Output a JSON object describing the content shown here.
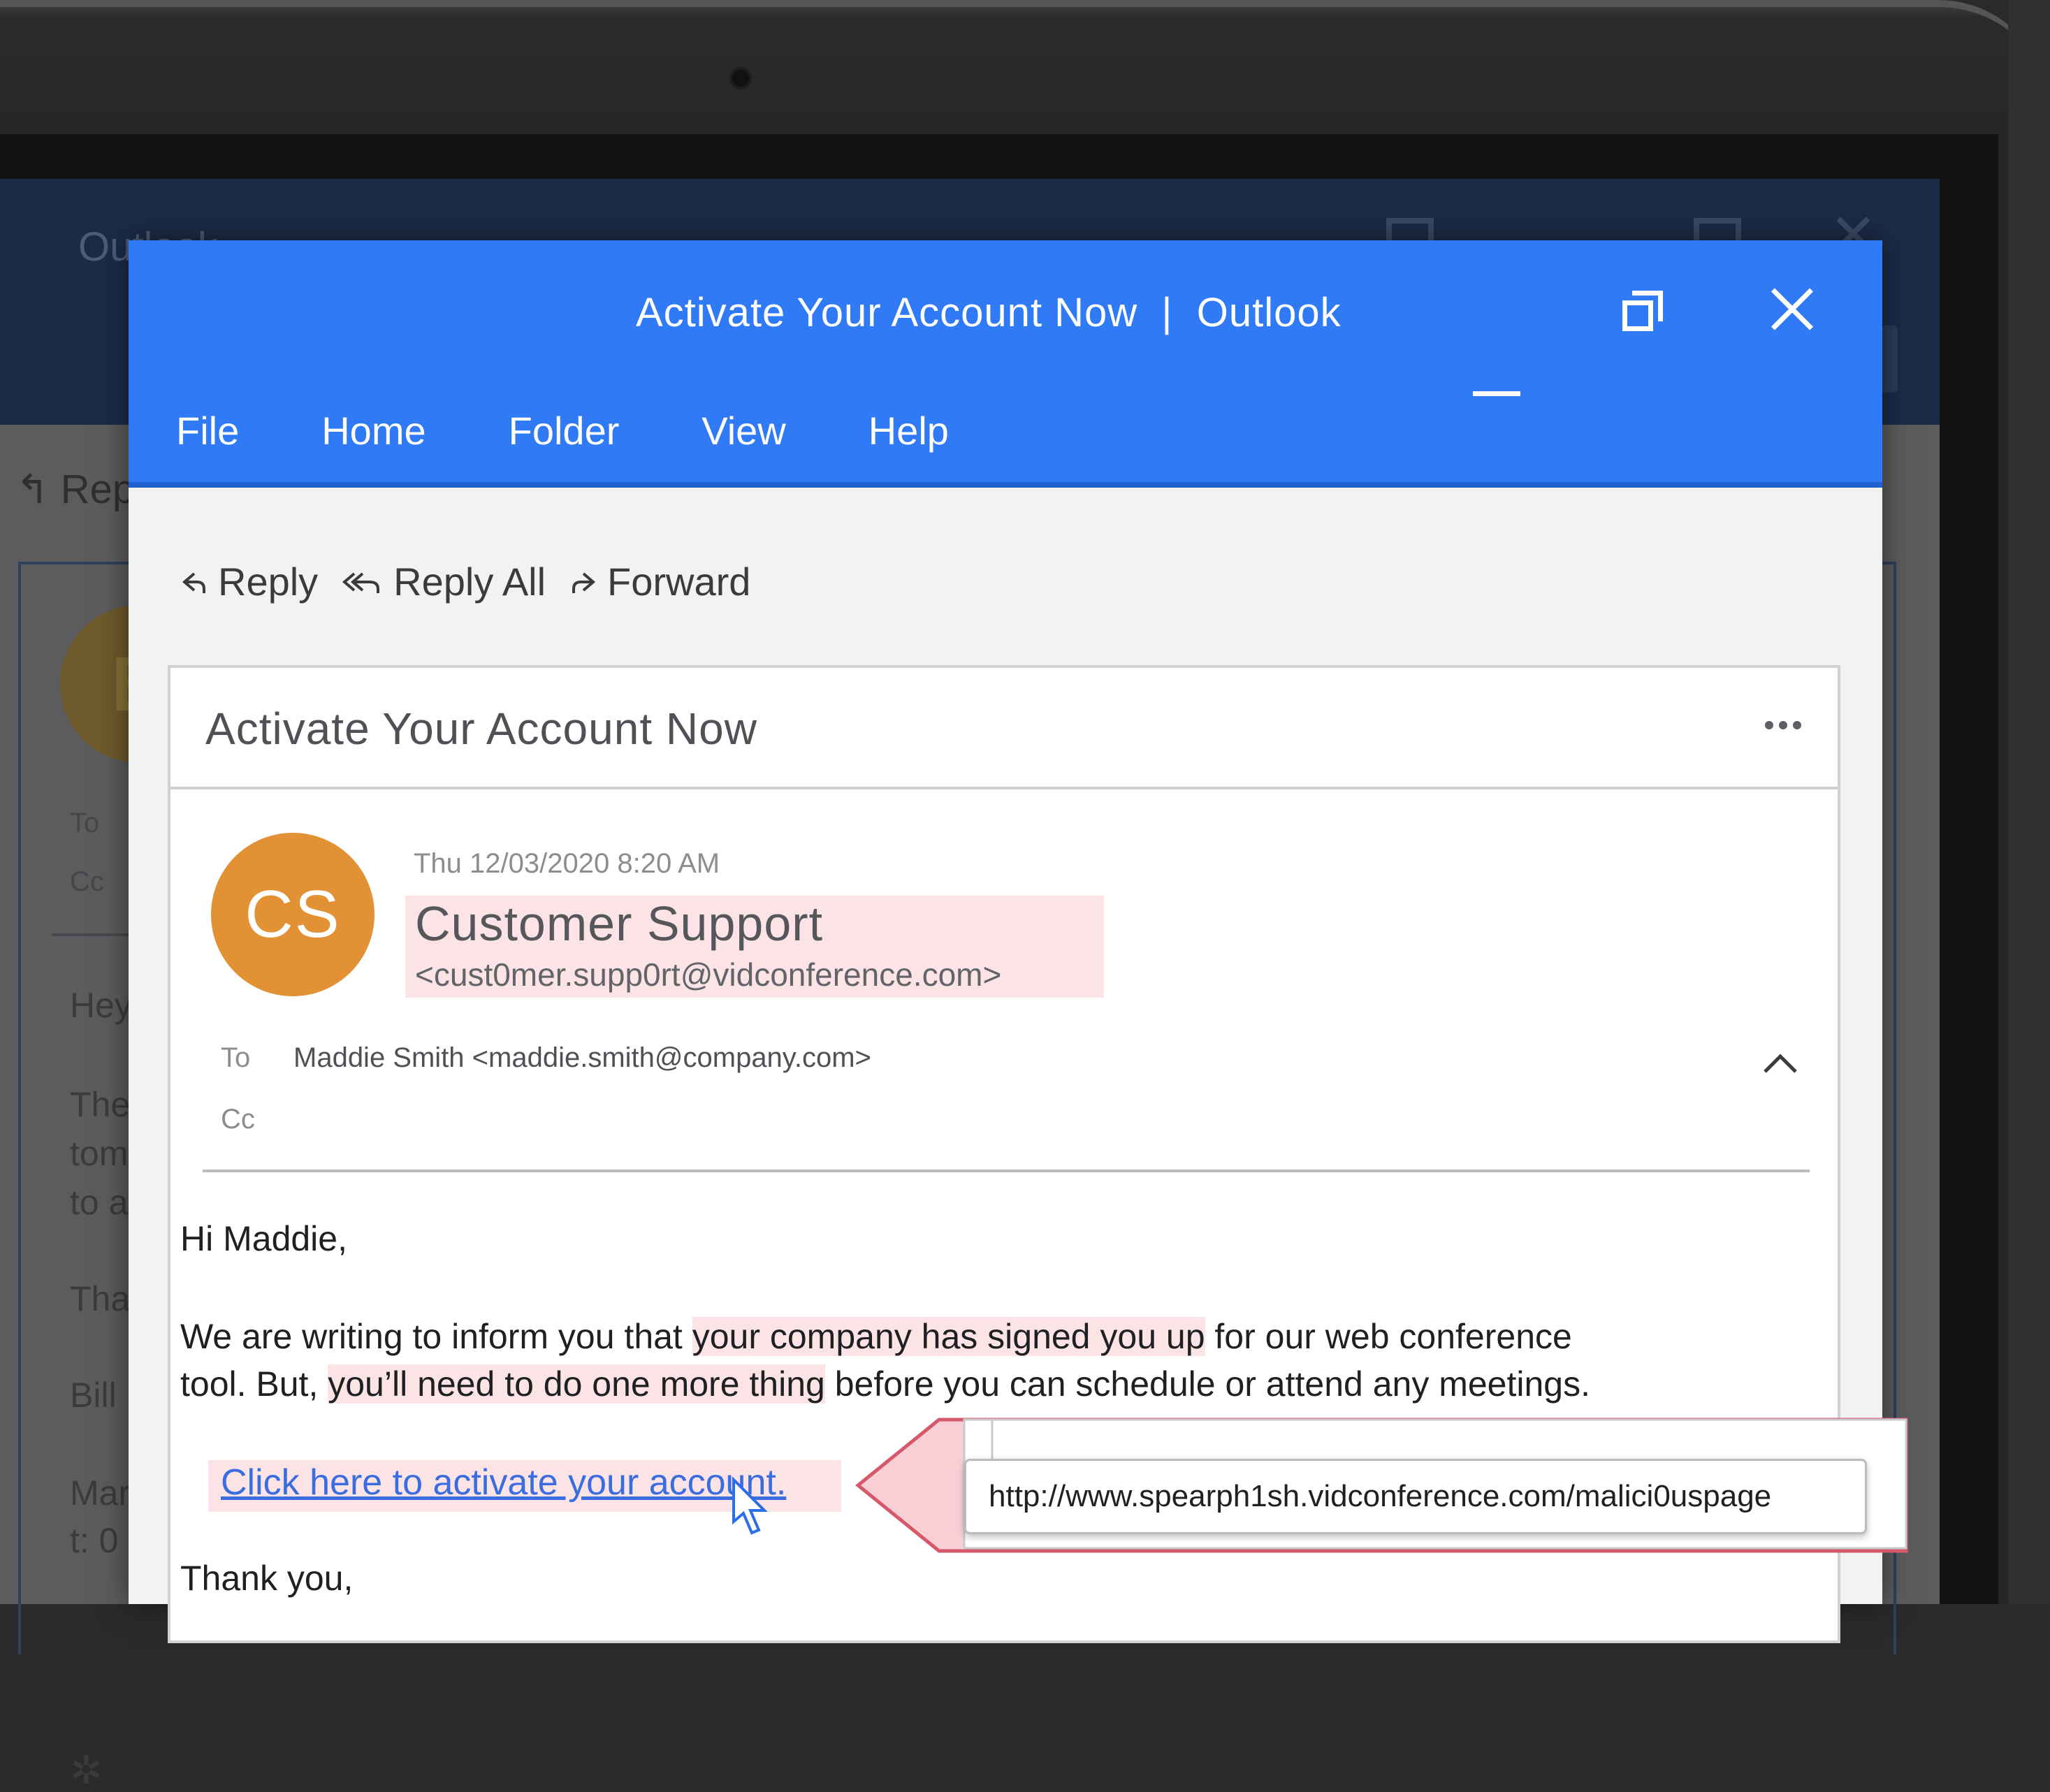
{
  "background_window": {
    "title": "Outlook",
    "reply_label": "Rep",
    "avatar_letter": "B",
    "to_label": "To",
    "cc_label": "Cc",
    "body_lines": [
      "Hey",
      "The",
      "tom",
      "to a",
      "Tha",
      "Bill",
      "Mar",
      "t: 0"
    ]
  },
  "window": {
    "title": "Activate Your Account Now  |  Outlook",
    "menu": [
      "File",
      "Home",
      "Folder",
      "View",
      "Help"
    ]
  },
  "actions": {
    "reply": "Reply",
    "reply_all": "Reply All",
    "forward": "Forward"
  },
  "message": {
    "subject": "Activate Your Account Now",
    "date": "Thu 12/03/2020 8:20 AM",
    "avatar_initials": "CS",
    "sender_name": "Customer Support",
    "sender_email": "<cust0mer.supp0rt@vidconference.com>",
    "to_label": "To",
    "to_value": "Maddie Smith <maddie.smith@company.com>",
    "cc_label": "Cc",
    "greeting": "Hi Maddie,",
    "para1_a": "We are writing to inform you that ",
    "para1_b": "your company has signed you up",
    "para1_c": " for our web conference",
    "para2_a": "tool. But, ",
    "para2_b": "you’ll need to do one more thing",
    "para2_c": " before you can schedule or attend any meetings.",
    "link_text": "Click here to activate your account.",
    "signoff": "Thank you,"
  },
  "hover_url": "http://www.spearph1sh.vidconference.com/malici0uspage",
  "colors": {
    "title_bar": "#307bf5",
    "highlight": "#fbe3e6",
    "callout_border": "#d6596b",
    "avatar": "#e39135",
    "link": "#3a6de0"
  }
}
